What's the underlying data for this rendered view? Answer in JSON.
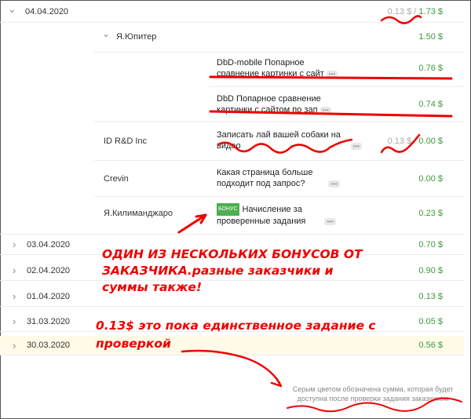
{
  "days": [
    {
      "date": "04.04.2020",
      "amount_pending": "0.13 $",
      "sep": "/",
      "amount": "1.73 $",
      "expanded": true
    },
    {
      "date": "03.04.2020",
      "amount": "0.70 $"
    },
    {
      "date": "02.04.2020",
      "amount": "0.90 $"
    },
    {
      "date": "01.04.2020",
      "amount": "0.13 $"
    },
    {
      "date": "31.03.2020",
      "amount": "0.05 $"
    },
    {
      "date": "30.03.2020",
      "amount": "0.56 $"
    }
  ],
  "groups": [
    {
      "client": "Я.Юпитер",
      "amount": "1.50 $"
    },
    {
      "client": "ID R&D Inc",
      "amount_pending": "0.13 $",
      "sep": "/",
      "amount": "0.00 $"
    },
    {
      "client": "Crevin",
      "amount": "0.00 $"
    },
    {
      "client": "Я.Килиманджаро",
      "amount": "0.23 $"
    }
  ],
  "tasks": [
    {
      "line1": "DbD-mobile Попарное",
      "line2": "сравнение картинки с сайт",
      "amount": "0.76 $"
    },
    {
      "line1": "DbD Попарное сравнение",
      "line2": "картинки с сайтом по зап",
      "amount": "0.74 $"
    },
    {
      "line1": "Записать лай вашей собаки на",
      "line2": "видео"
    },
    {
      "line1": "Какая страница больше",
      "line2": "подходит под запрос?"
    },
    {
      "badge": "БОНУС",
      "line1": "Начисление за",
      "line2": "проверенные задания"
    }
  ],
  "dots_label": "•••",
  "chevron_right": "›",
  "chevron_down": "⌄",
  "annotations": {
    "bonus_note_1": "ОДИН ИЗ НЕСКОЛЬКИХ БОНУСОВ ОТ",
    "bonus_note_2": "ЗАКАЗЧИКА.разные заказчики и",
    "bonus_note_3": "суммы также!",
    "check_note_1": "0.13$  это пока единственное задание с",
    "check_note_2": "проверкой"
  },
  "footnote": {
    "line1": "Серым цветом обозначена сумма, которая будет",
    "line2": "доступна после проверки задания заказчиком"
  },
  "colors": {
    "green": "#3c9a3c",
    "gray": "#aaaaaa",
    "annotation_red": "#e00000",
    "bonus_badge": "#4caf50"
  }
}
